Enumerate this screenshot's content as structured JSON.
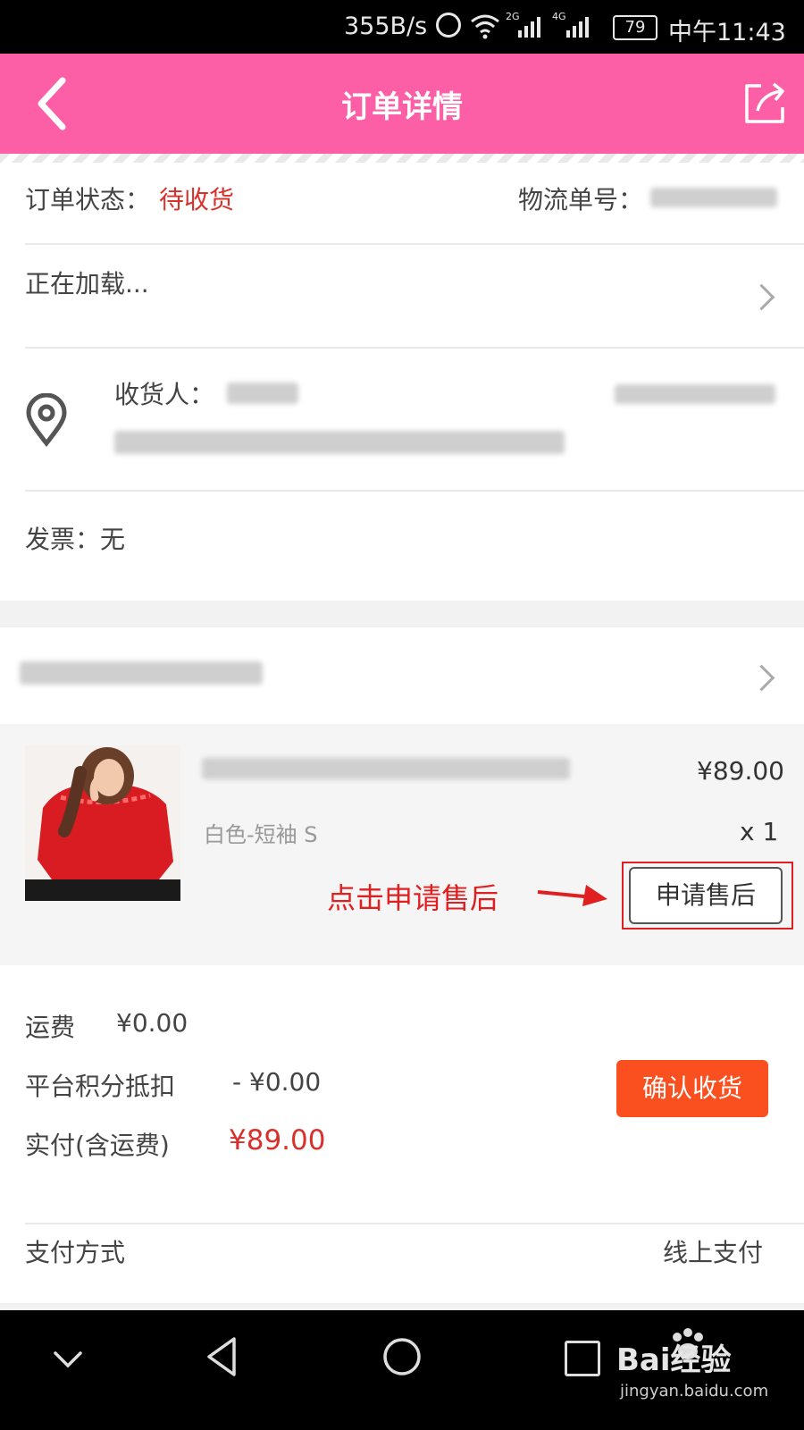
{
  "status_bar": {
    "net_speed": "355B/s",
    "sig_2g": "2G",
    "sig_4g": "4G",
    "battery": "79",
    "time": "中午11:43"
  },
  "header": {
    "title": "订单详情"
  },
  "order": {
    "status_label": "订单状态：",
    "status_value": "待收货",
    "tracking_label": "物流单号："
  },
  "logistics": {
    "loading_text": "正在加载..."
  },
  "address": {
    "receiver_label": "收货人："
  },
  "invoice": {
    "label": "发票：无"
  },
  "product": {
    "price": "¥89.00",
    "spec": "白色-短袖 S",
    "quantity": "x 1",
    "after_sale_button": "申请售后",
    "annotation": "点击申请售后"
  },
  "summary": {
    "shipping_label": "运费",
    "shipping_value": "¥0.00",
    "points_label": "平台积分抵扣",
    "points_value": "- ¥0.00",
    "paid_label": "实付(含运费)",
    "paid_value": "¥89.00",
    "confirm_button": "确认收货"
  },
  "payment": {
    "label": "支付方式",
    "value": "线上支付"
  },
  "watermark": {
    "brand": "Bai经验",
    "url": "jingyan.baidu.com"
  },
  "colors": {
    "header_pink": "#fc5fa6",
    "price_red": "#d8302a",
    "confirm_orange": "#fa4f1e",
    "annotation_red": "#e02020"
  }
}
